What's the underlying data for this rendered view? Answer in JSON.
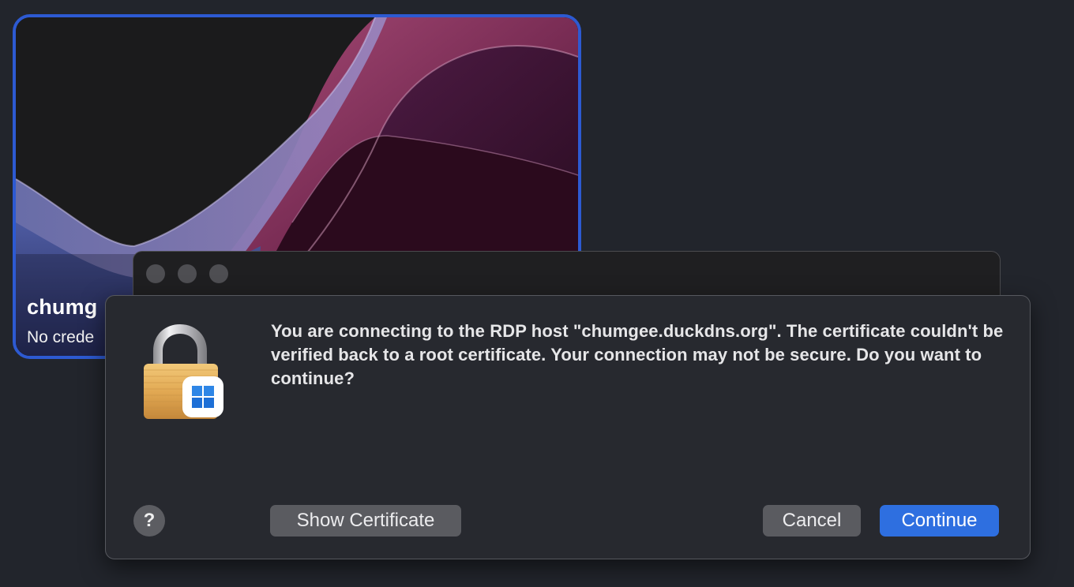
{
  "pc_tile": {
    "name": "chumg",
    "subtitle": "No crede"
  },
  "dialog": {
    "message": "You are connecting to the RDP host \"chumgee.duckdns.org\". The certificate couldn't be verified back to a root certificate. Your connection may not be secure. Do you want to continue?",
    "help_label": "?",
    "show_certificate_label": "Show Certificate",
    "cancel_label": "Cancel",
    "continue_label": "Continue"
  },
  "icons": {
    "lock": "lock-icon",
    "windows": "windows-logo-icon"
  },
  "colors": {
    "accent_blue": "#2e6fe0",
    "tile_border": "#2d5ad2",
    "background": "#22252c"
  }
}
